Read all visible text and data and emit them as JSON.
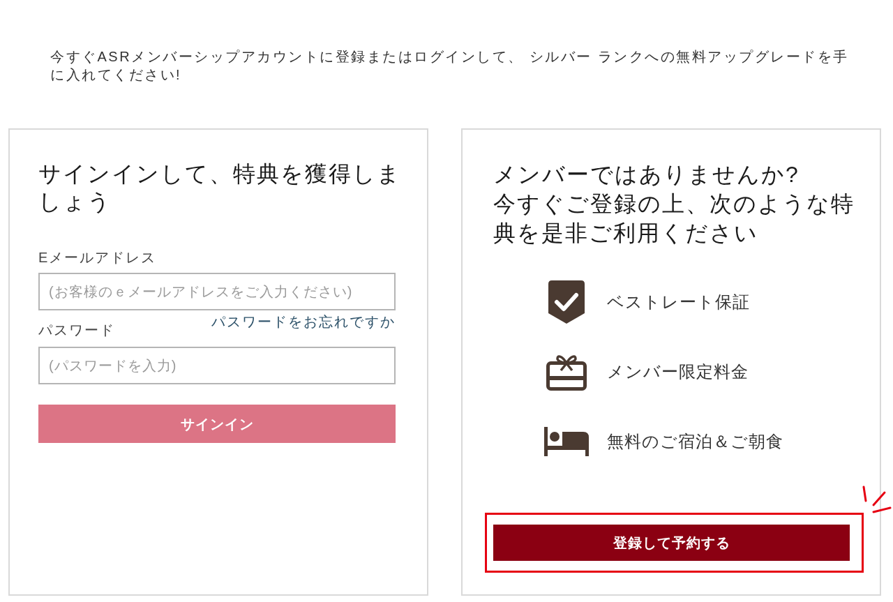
{
  "intro": "今すぐASRメンバーシップアカウントに登録またはログインして、 シルバー ランクへの無料アップグレードを手に入れてください!",
  "sign_in": {
    "title": "サインインして、特典を獲得しましょう",
    "email": {
      "label": "Eメールアドレス",
      "placeholder": "(お客様のｅメールアドレスをご入力ください)"
    },
    "forgot_password_link": "パスワードをお忘れですか",
    "password": {
      "label": "パスワード",
      "placeholder": "(パスワードを入力)"
    },
    "button": {
      "label": "サインイン",
      "disabled": true
    }
  },
  "join": {
    "title_lines": [
      "メンバーではありませんか?",
      "今すぐご登録の上、次のような特典を是非ご利用ください"
    ],
    "benefits": [
      "ベストレート保証",
      "メンバー限定料金",
      "無料のご宿泊＆ご朝食"
    ],
    "button": {
      "label": "登録して予約する",
      "highlighted": true
    }
  }
}
